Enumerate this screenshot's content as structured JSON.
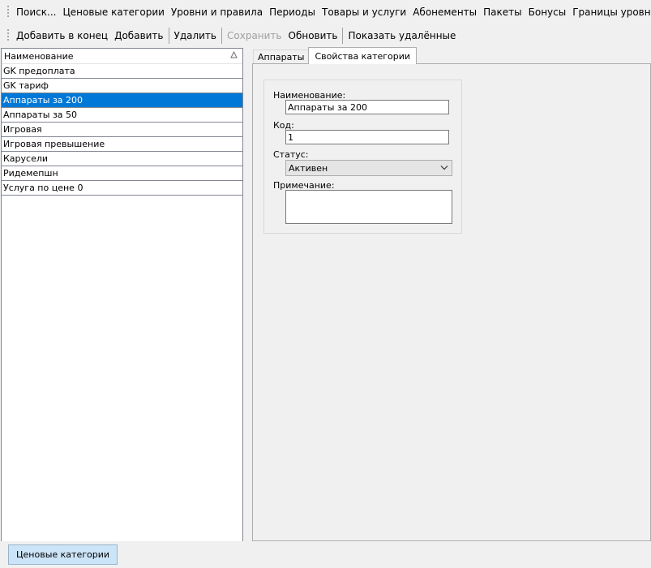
{
  "menubar": {
    "items": [
      "Поиск...",
      "Ценовые категории",
      "Уровни и правила",
      "Периоды",
      "Товары и услуги",
      "Абонементы",
      "Пакеты",
      "Бонусы",
      "Границы уровней"
    ]
  },
  "toolbar": {
    "add_to_end": "Добавить в конец",
    "add": "Добавить",
    "delete": "Удалить",
    "save": "Сохранить",
    "refresh": "Обновить",
    "show_deleted": "Показать удалённые"
  },
  "list": {
    "header": "Наименование",
    "rows": [
      "GK  предоплата",
      "GK тариф",
      "Аппараты за 200",
      "Аппараты за 50",
      "Игровая",
      "Игровая превышение",
      "Карусели",
      "Ридемепшн",
      "Услуга по цене 0"
    ],
    "selected_index": 2
  },
  "tabs": [
    "Аппараты",
    "Свойства категории"
  ],
  "form": {
    "name_label": "Наименование:",
    "name_value": "Аппараты за 200",
    "code_label": "Код:",
    "code_value": "1",
    "status_label": "Статус:",
    "status_value": "Активен",
    "note_label": "Примечание:",
    "note_value": ""
  },
  "taskbar": {
    "button": "Ценовые категории"
  },
  "colors": {
    "selection": "#0078d7",
    "window_bg": "#f0f0f0",
    "task_button": "#cce4f7"
  }
}
